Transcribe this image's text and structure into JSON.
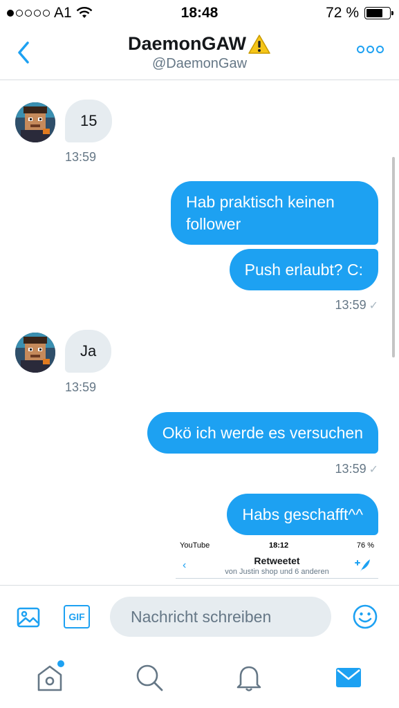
{
  "status_bar": {
    "carrier": "A1",
    "time": "18:48",
    "battery": "72 %",
    "battery_level": 0.72
  },
  "header": {
    "name": "DaemonGAW",
    "handle": "@DaemonGaw"
  },
  "messages": [
    {
      "direction": "in",
      "text": "15",
      "time": "13:59"
    },
    {
      "direction": "out",
      "text": "Hab praktisch keinen follower"
    },
    {
      "direction": "out",
      "text": "Push erlaubt? C:",
      "time": "13:59"
    },
    {
      "direction": "in",
      "text": "Ja",
      "time": "13:59"
    },
    {
      "direction": "out",
      "text": "Okö ich werde es versuchen",
      "time": "13:59"
    },
    {
      "direction": "out",
      "text": "Habs geschafft^^"
    }
  ],
  "embedded_screenshot": {
    "app": "YouTube",
    "time": "18:12",
    "battery": "76 %",
    "title": "Retweetet",
    "subtitle": "von Justin shop und 6 anderen"
  },
  "composer": {
    "placeholder": "Nachricht schreiben",
    "gif_label": "GIF"
  },
  "colors": {
    "accent": "#1da1f2",
    "incoming_bubble": "#e6ecf0",
    "secondary_text": "#657786"
  },
  "icons": [
    "back-chevron-icon",
    "warning-icon",
    "more-icon",
    "image-icon",
    "gif-icon",
    "emoji-icon",
    "home-icon",
    "search-icon",
    "notifications-icon",
    "messages-icon"
  ]
}
